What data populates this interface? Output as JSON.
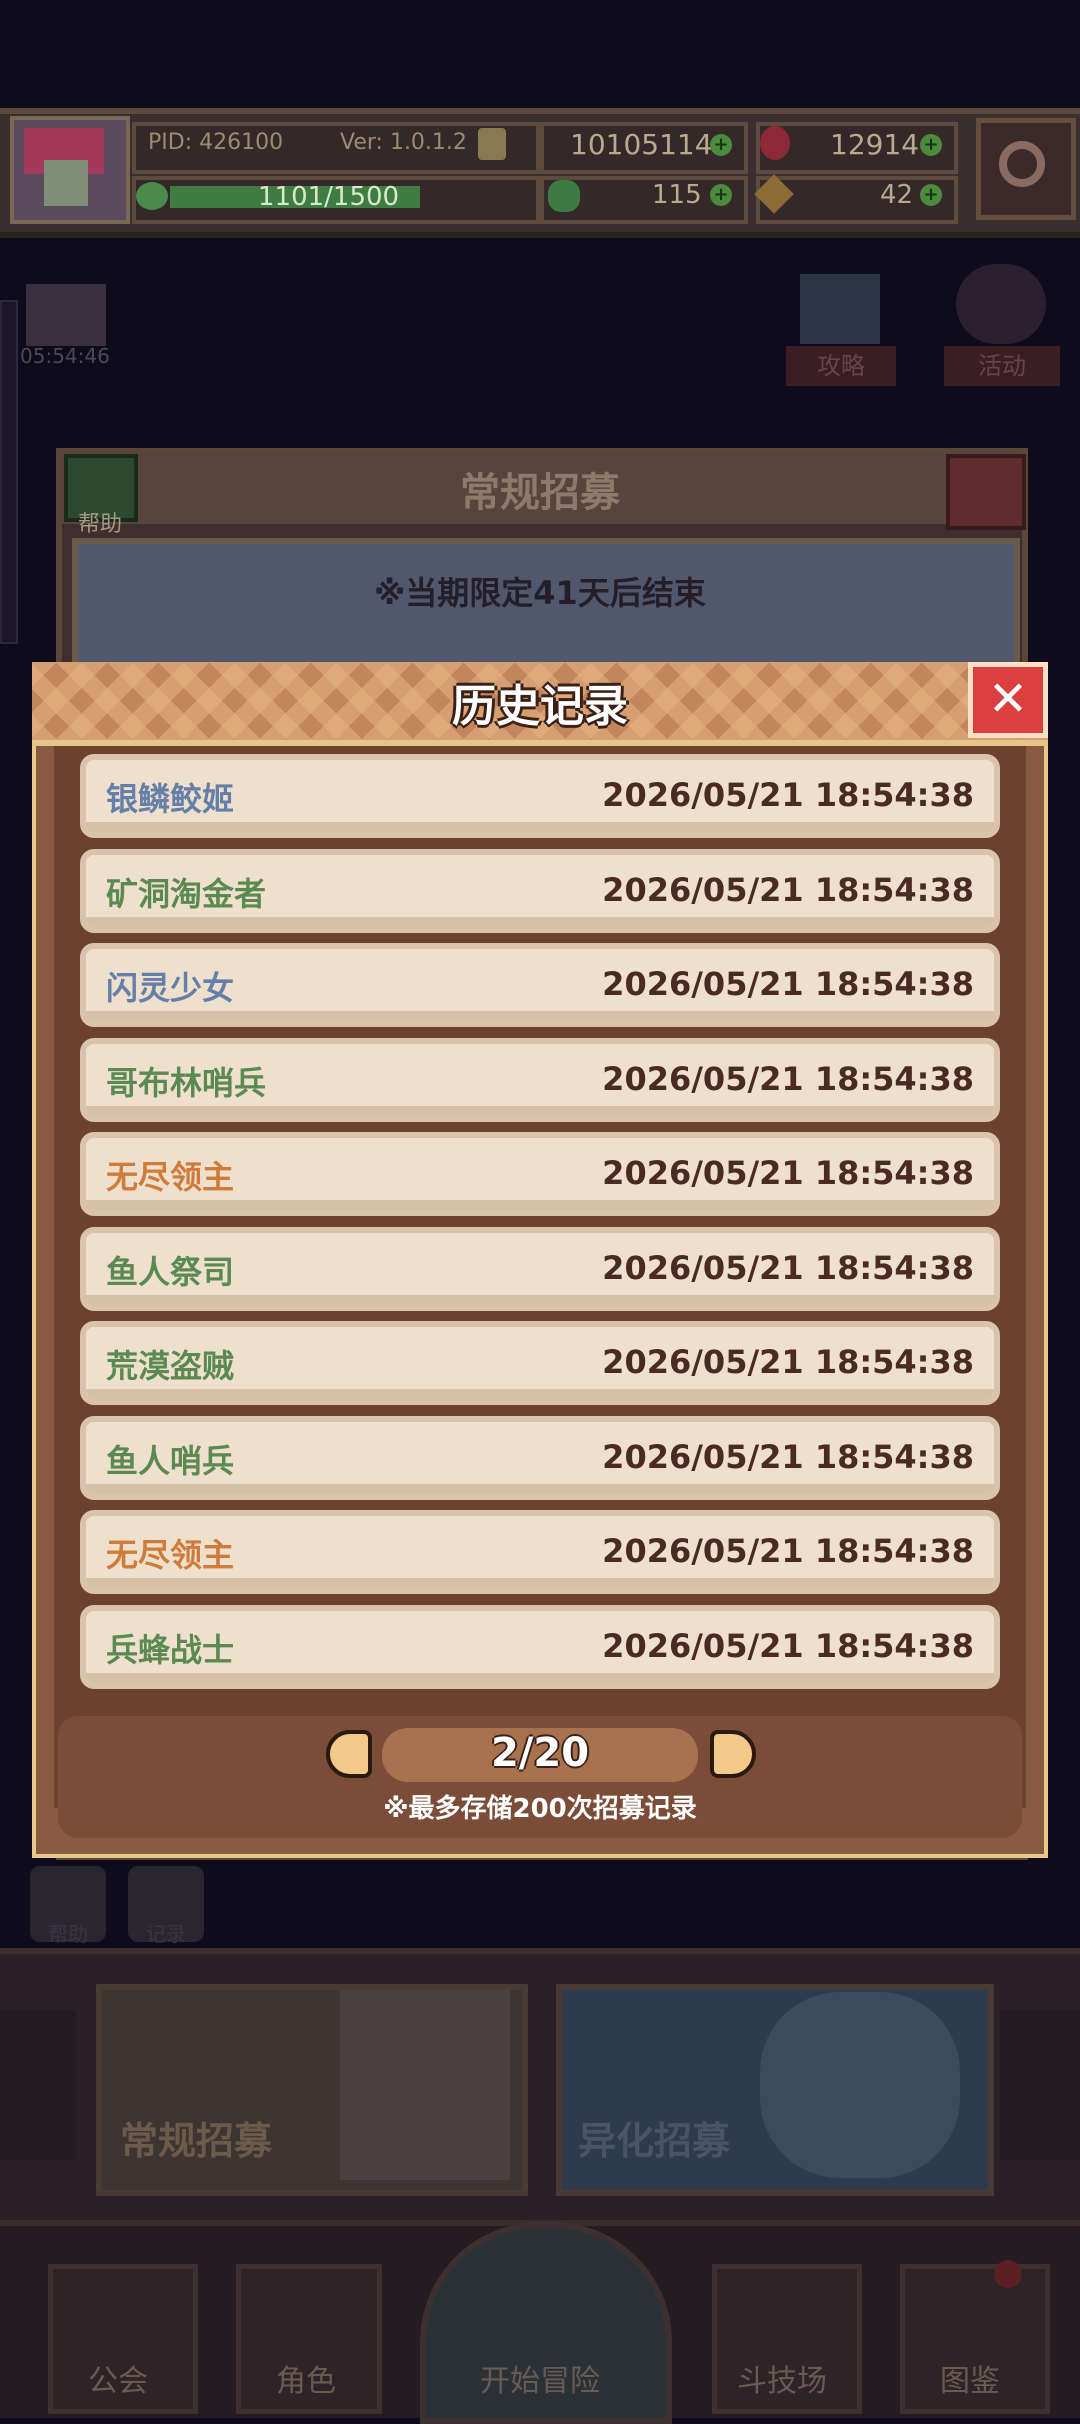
{
  "status": {
    "pid": "PID: 426100",
    "version": "Ver: 1.0.1.2",
    "gold": "10105114",
    "gems": "12914",
    "stamina": "1101/1500",
    "stamina_fraction": 0.734,
    "clover": "115",
    "hammer": "42"
  },
  "side": {
    "timer": "05:54:46",
    "guide_label": "攻略",
    "event_label": "活动"
  },
  "recruit_panel": {
    "title": "常规招募",
    "help_label": "帮助",
    "notice": "※当期限定41天后结束"
  },
  "small_buttons": {
    "first": "帮助",
    "second": "记录"
  },
  "banners": {
    "regular": "常规招募",
    "mutation": "异化招募"
  },
  "nav": {
    "guild": "公会",
    "character": "角色",
    "adventure": "开始冒险",
    "arena": "斗技场",
    "codex": "图鉴"
  },
  "history": {
    "title": "历史记录",
    "close_icon": "close-icon",
    "records": [
      {
        "name": "银鳞鲛姬",
        "time": "2026/05/21 18:54:38",
        "color": "#6580a8"
      },
      {
        "name": "矿洞淘金者",
        "time": "2026/05/21 18:54:38",
        "color": "#5a8a52"
      },
      {
        "name": "闪灵少女",
        "time": "2026/05/21 18:54:38",
        "color": "#6580a8"
      },
      {
        "name": "哥布林哨兵",
        "time": "2026/05/21 18:54:38",
        "color": "#5a8a52"
      },
      {
        "name": "无尽领主",
        "time": "2026/05/21 18:54:38",
        "color": "#cf7b3a"
      },
      {
        "name": "鱼人祭司",
        "time": "2026/05/21 18:54:38",
        "color": "#5a8a52"
      },
      {
        "name": "荒漠盗贼",
        "time": "2026/05/21 18:54:38",
        "color": "#5a8a52"
      },
      {
        "name": "鱼人哨兵",
        "time": "2026/05/21 18:54:38",
        "color": "#5a8a52"
      },
      {
        "name": "无尽领主",
        "time": "2026/05/21 18:54:38",
        "color": "#cf7b3a"
      },
      {
        "name": "兵蜂战士",
        "time": "2026/05/21 18:54:38",
        "color": "#5a8a52"
      }
    ],
    "page": "2/20",
    "note": "※最多存储200次招募记录"
  }
}
